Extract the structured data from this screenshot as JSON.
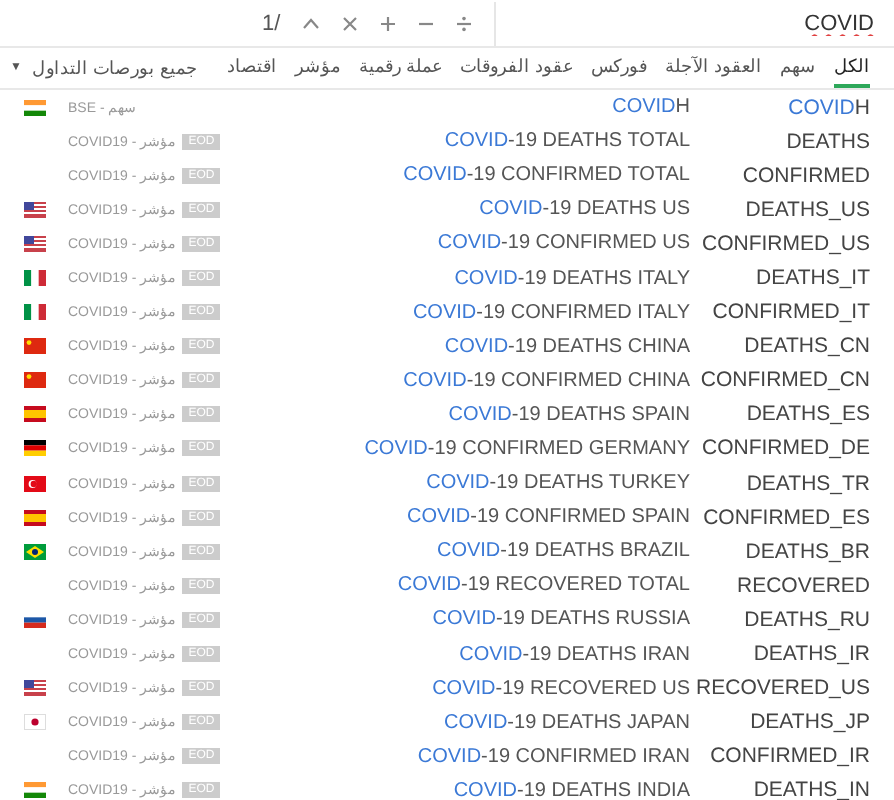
{
  "toolbar": {
    "counter": "1/",
    "search": {
      "value": "COVID"
    }
  },
  "tabs": [
    {
      "label": "الكل",
      "selected": true
    },
    {
      "label": "سهم",
      "selected": false
    },
    {
      "label": "العقود الآجلة",
      "selected": false
    },
    {
      "label": "فوركس",
      "selected": false
    },
    {
      "label": "عقود الفروقات",
      "selected": false
    },
    {
      "label": "عملة رقمية",
      "selected": false
    },
    {
      "label": "مؤشر",
      "selected": false
    },
    {
      "label": "اقتصاد",
      "selected": false
    }
  ],
  "exchange_filter": {
    "label": "جميع بورصات التداول",
    "icon": "▼"
  },
  "results": [
    {
      "kind": "in",
      "exchange": "BSE - سهم",
      "symbol": [
        {
          "text": "COVID",
          "match": true
        },
        {
          "text": "H",
          "match": false
        }
      ],
      "description": [
        {
          "text": "COVID",
          "match": true
        },
        {
          "text": "H",
          "match": false
        }
      ]
    },
    {
      "exchange": "COVID19 - مؤشر",
      "badge": "EOD",
      "symbol": [
        {
          "text": "DEATHS",
          "match": false
        }
      ],
      "description": [
        {
          "text": "COVID",
          "match": true
        },
        {
          "text": "-19 DEATHS TOTAL",
          "match": false
        }
      ]
    },
    {
      "exchange": "COVID19 - مؤشر",
      "badge": "EOD",
      "symbol": [
        {
          "text": "CONFIRMED",
          "match": false
        }
      ],
      "description": [
        {
          "text": "COVID",
          "match": true
        },
        {
          "text": "-19 CONFIRMED TOTAL",
          "match": false
        }
      ]
    },
    {
      "kind": "us",
      "exchange": "COVID19 - مؤشر",
      "badge": "EOD",
      "symbol": [
        {
          "text": "DEATHS_US",
          "match": false
        }
      ],
      "description": [
        {
          "text": "COVID",
          "match": true
        },
        {
          "text": "-19 DEATHS US",
          "match": false
        }
      ]
    },
    {
      "kind": "us",
      "exchange": "COVID19 - مؤشر",
      "badge": "EOD",
      "symbol": [
        {
          "text": "CONFIRMED_US",
          "match": false
        }
      ],
      "description": [
        {
          "text": "COVID",
          "match": true
        },
        {
          "text": "-19 CONFIRMED US",
          "match": false
        }
      ]
    },
    {
      "kind": "it",
      "exchange": "COVID19 - مؤشر",
      "badge": "EOD",
      "symbol": [
        {
          "text": "DEATHS_IT",
          "match": false
        }
      ],
      "description": [
        {
          "text": "COVID",
          "match": true
        },
        {
          "text": "-19 DEATHS ITALY",
          "match": false
        }
      ]
    },
    {
      "kind": "it",
      "exchange": "COVID19 - مؤشر",
      "badge": "EOD",
      "symbol": [
        {
          "text": "CONFIRMED_IT",
          "match": false
        }
      ],
      "description": [
        {
          "text": "COVID",
          "match": true
        },
        {
          "text": "-19 CONFIRMED ITALY",
          "match": false
        }
      ]
    },
    {
      "kind": "cn",
      "exchange": "COVID19 - مؤشر",
      "badge": "EOD",
      "symbol": [
        {
          "text": "DEATHS_CN",
          "match": false
        }
      ],
      "description": [
        {
          "text": "COVID",
          "match": true
        },
        {
          "text": "-19 DEATHS CHINA",
          "match": false
        }
      ]
    },
    {
      "kind": "cn",
      "exchange": "COVID19 - مؤشر",
      "badge": "EOD",
      "symbol": [
        {
          "text": "CONFIRMED_CN",
          "match": false
        }
      ],
      "description": [
        {
          "text": "COVID",
          "match": true
        },
        {
          "text": "-19 CONFIRMED CHINA",
          "match": false
        }
      ]
    },
    {
      "kind": "es",
      "exchange": "COVID19 - مؤشر",
      "badge": "EOD",
      "symbol": [
        {
          "text": "DEATHS_ES",
          "match": false
        }
      ],
      "description": [
        {
          "text": "COVID",
          "match": true
        },
        {
          "text": "-19 DEATHS SPAIN",
          "match": false
        }
      ]
    },
    {
      "kind": "de",
      "exchange": "COVID19 - مؤشر",
      "badge": "EOD",
      "symbol": [
        {
          "text": "CONFIRMED_DE",
          "match": false
        }
      ],
      "description": [
        {
          "text": "COVID",
          "match": true
        },
        {
          "text": "-19 CONFIRMED GERMANY",
          "match": false
        }
      ]
    },
    {
      "kind": "tr",
      "exchange": "COVID19 - مؤشر",
      "badge": "EOD",
      "symbol": [
        {
          "text": "DEATHS_TR",
          "match": false
        }
      ],
      "description": [
        {
          "text": "COVID",
          "match": true
        },
        {
          "text": "-19 DEATHS TURKEY",
          "match": false
        }
      ]
    },
    {
      "kind": "es",
      "exchange": "COVID19 - مؤشر",
      "badge": "EOD",
      "symbol": [
        {
          "text": "CONFIRMED_ES",
          "match": false
        }
      ],
      "description": [
        {
          "text": "COVID",
          "match": true
        },
        {
          "text": "-19 CONFIRMED SPAIN",
          "match": false
        }
      ]
    },
    {
      "kind": "br",
      "exchange": "COVID19 - مؤشر",
      "badge": "EOD",
      "symbol": [
        {
          "text": "DEATHS_BR",
          "match": false
        }
      ],
      "description": [
        {
          "text": "COVID",
          "match": true
        },
        {
          "text": "-19 DEATHS BRAZIL",
          "match": false
        }
      ]
    },
    {
      "exchange": "COVID19 - مؤشر",
      "badge": "EOD",
      "symbol": [
        {
          "text": "RECOVERED",
          "match": false
        }
      ],
      "description": [
        {
          "text": "COVID",
          "match": true
        },
        {
          "text": "-19 RECOVERED TOTAL",
          "match": false
        }
      ]
    },
    {
      "kind": "ru",
      "exchange": "COVID19 - مؤشر",
      "badge": "EOD",
      "symbol": [
        {
          "text": "DEATHS_RU",
          "match": false
        }
      ],
      "description": [
        {
          "text": "COVID",
          "match": true
        },
        {
          "text": "-19 DEATHS RUSSIA",
          "match": false
        }
      ]
    },
    {
      "exchange": "COVID19 - مؤشر",
      "badge": "EOD",
      "symbol": [
        {
          "text": "DEATHS_IR",
          "match": false
        }
      ],
      "description": [
        {
          "text": "COVID",
          "match": true
        },
        {
          "text": "-19 DEATHS IRAN",
          "match": false
        }
      ]
    },
    {
      "kind": "us",
      "exchange": "COVID19 - مؤشر",
      "badge": "EOD",
      "symbol": [
        {
          "text": "RECOVERED_US",
          "match": false
        }
      ],
      "description": [
        {
          "text": "COVID",
          "match": true
        },
        {
          "text": "-19 RECOVERED US",
          "match": false
        }
      ]
    },
    {
      "kind": "jp",
      "exchange": "COVID19 - مؤشر",
      "badge": "EOD",
      "symbol": [
        {
          "text": "DEATHS_JP",
          "match": false
        }
      ],
      "description": [
        {
          "text": "COVID",
          "match": true
        },
        {
          "text": "-19 DEATHS JAPAN",
          "match": false
        }
      ]
    },
    {
      "exchange": "COVID19 - مؤشر",
      "badge": "EOD",
      "symbol": [
        {
          "text": "CONFIRMED_IR",
          "match": false
        }
      ],
      "description": [
        {
          "text": "COVID",
          "match": true
        },
        {
          "text": "-19 CONFIRMED IRAN",
          "match": false
        }
      ]
    },
    {
      "kind": "in",
      "exchange": "COVID19 - مؤشر",
      "badge": "EOD",
      "symbol": [
        {
          "text": "DEATHS_IN",
          "match": false
        }
      ],
      "description": [
        {
          "text": "COVID",
          "match": true
        },
        {
          "text": "-19 DEATHS INDIA",
          "match": false
        }
      ]
    }
  ]
}
